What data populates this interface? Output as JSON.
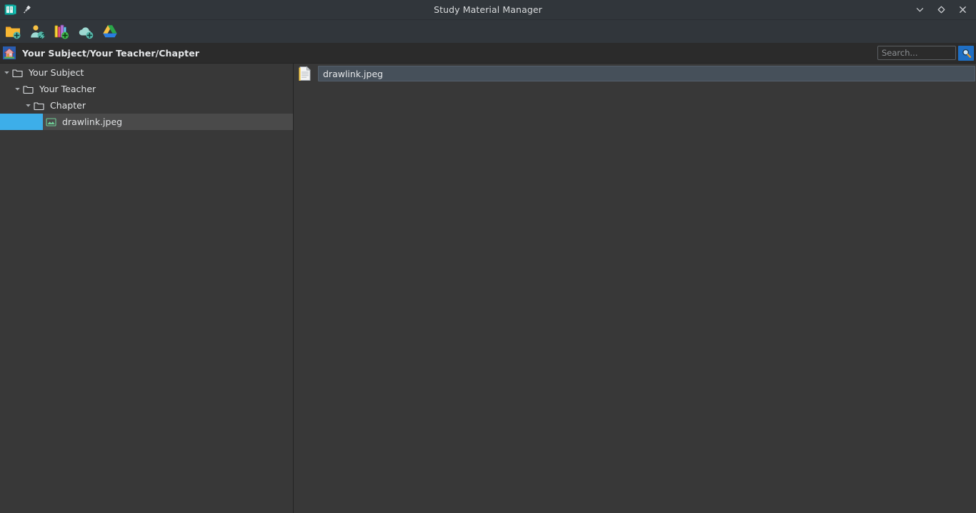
{
  "window": {
    "title": "Study Material Manager",
    "app_icon": "book-icon",
    "pin_icon": "pin-icon",
    "controls": [
      {
        "name": "minimize-button",
        "icon": "chevron-down-icon",
        "glyph": "v"
      },
      {
        "name": "maximize-button",
        "icon": "diamond-icon",
        "glyph": "diamond"
      },
      {
        "name": "close-button",
        "icon": "close-icon",
        "glyph": "x"
      }
    ]
  },
  "toolbar": {
    "buttons": [
      {
        "name": "add-folder-button",
        "icon": "add-folder-icon",
        "tooltip": "Add Folder"
      },
      {
        "name": "add-teacher-button",
        "icon": "add-person-link-icon",
        "tooltip": "Add Teacher"
      },
      {
        "name": "add-books-button",
        "icon": "add-books-icon",
        "tooltip": "Add Books"
      },
      {
        "name": "add-cloud-button",
        "icon": "add-cloud-icon",
        "tooltip": "Add Cloud"
      },
      {
        "name": "google-drive-button",
        "icon": "google-drive-icon",
        "tooltip": "Google Drive"
      }
    ]
  },
  "location_bar": {
    "home_icon": "home-icon",
    "breadcrumb": "Your Subject/Your Teacher/Chapter"
  },
  "search": {
    "placeholder": "Search...",
    "value": "",
    "button_icon": "magnifier-icon",
    "accent": "#1f6fc4"
  },
  "sidebar": {
    "tree": [
      {
        "label": "Your Subject",
        "icon": "folder-icon",
        "depth": 0,
        "expanded": true,
        "selected": false,
        "twisty": "chevron-down-icon"
      },
      {
        "label": "Your Teacher",
        "icon": "folder-icon",
        "depth": 1,
        "expanded": true,
        "selected": false,
        "twisty": "chevron-down-icon"
      },
      {
        "label": "Chapter",
        "icon": "folder-icon",
        "depth": 2,
        "expanded": true,
        "selected": false,
        "twisty": "chevron-down-icon"
      },
      {
        "label": "drawlink.jpeg",
        "icon": "image-file-icon",
        "depth": 3,
        "expanded": false,
        "selected": true,
        "twisty": "none"
      }
    ],
    "selection_color": "#3daee9"
  },
  "main": {
    "items": [
      {
        "label": "drawlink.jpeg",
        "icon": "document-icon",
        "selected": true
      }
    ]
  },
  "colors": {
    "window_chrome": "#31363b",
    "content_bg": "#383838",
    "locbar_bg": "#2b2b2b",
    "selection_blue": "#3daee9",
    "accent_blue": "#1f6fc4"
  }
}
